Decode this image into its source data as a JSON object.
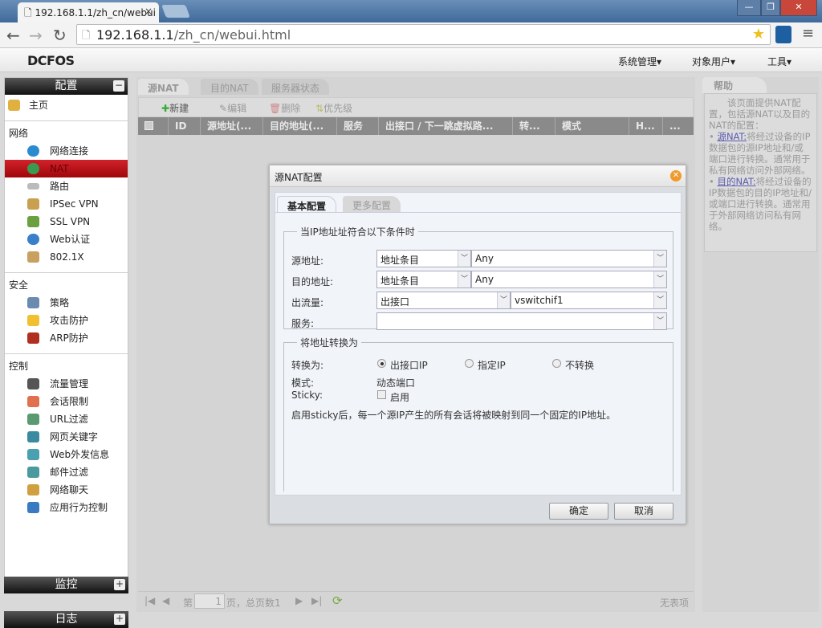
{
  "browser": {
    "tab_title": "192.168.1.1/zh_cn/webui",
    "url_host": "192.168.1.1",
    "url_path": "/zh_cn/webui.html",
    "close": "×"
  },
  "app": {
    "logo": "DCFOS",
    "menus": [
      "系统管理▾",
      "对象用户▾",
      "工具▾"
    ]
  },
  "sidebar": {
    "header": "配置",
    "home": "主页",
    "groups": [
      {
        "title": "网络",
        "items": [
          "网络连接",
          "NAT",
          "路由",
          "IPSec VPN",
          "SSL VPN",
          "Web认证",
          "802.1X"
        ]
      },
      {
        "title": "安全",
        "items": [
          "策略",
          "攻击防护",
          "ARP防护"
        ]
      },
      {
        "title": "控制",
        "items": [
          "流量管理",
          "会话限制",
          "URL过滤",
          "网页关键字",
          "Web外发信息",
          "邮件过滤",
          "网络聊天",
          "应用行为控制"
        ]
      }
    ],
    "active": "NAT",
    "bottom": [
      "监控",
      "日志"
    ]
  },
  "main": {
    "tabs": [
      "源NAT",
      "目的NAT",
      "服务器状态"
    ],
    "toolbar": [
      "新建",
      "编辑",
      "删除",
      "优先级"
    ],
    "columns": [
      "ID",
      "源地址(...",
      "目的地址(...",
      "服务",
      "出接口 / 下一跳虚拟路...",
      "转...",
      "模式",
      "H...",
      "..."
    ],
    "pager": {
      "prefix": "第",
      "page": "1",
      "suffix": "页，总页数1",
      "status": "无表项"
    }
  },
  "help": {
    "title": "帮助",
    "intro": "该页面提供NAT配置，包括源NAT以及目的NAT的配置：",
    "items": [
      {
        "link": "源NAT:",
        "text": "将经过设备的IP数据包的源IP地址和/或端口进行转换。通常用于私有网络访问外部网络。"
      },
      {
        "link": "目的NAT:",
        "text": "将经过设备的IP数据包的目的IP地址和/或端口进行转换。通常用于外部网络访问私有网络。"
      }
    ]
  },
  "dialog": {
    "title": "源NAT配置",
    "tabs": [
      "基本配置",
      "更多配置"
    ],
    "cond_legend": "当IP地址址符合以下条件时",
    "src_label": "源地址:",
    "src_type": "地址条目",
    "src_value": "Any",
    "dst_label": "目的地址:",
    "dst_type": "地址条目",
    "dst_value": "Any",
    "egress_label": "出流量:",
    "egress_type": "出接口",
    "egress_value": "vswitchif1",
    "service_label": "服务:",
    "service_value": "",
    "trans_legend": "将地址转换为",
    "trans_label": "转换为:",
    "trans_options": [
      "出接口IP",
      "指定IP",
      "不转换"
    ],
    "trans_selected": "出接口IP",
    "mode_label": "模式:",
    "mode_value": "动态端口",
    "sticky_label": "Sticky:",
    "sticky_checkbox": "启用",
    "sticky_checked": false,
    "note": "启用sticky后，每一个源IP产生的所有会话将被映射到同一个固定的IP地址。",
    "ok": "确定",
    "cancel": "取消"
  }
}
